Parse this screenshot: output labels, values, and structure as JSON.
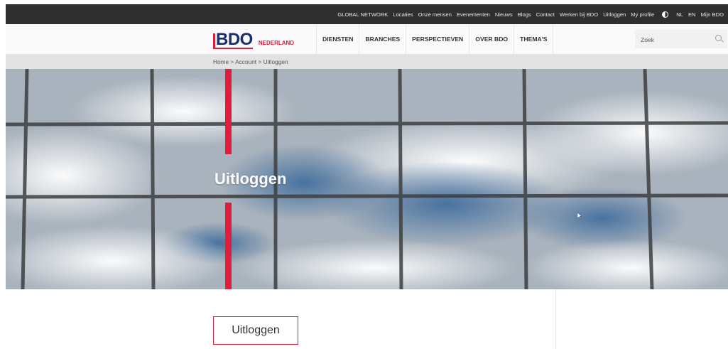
{
  "topbar": {
    "links": [
      "GLOBAL NETWORK",
      "Locaties",
      "Onze mensen",
      "Evenementen",
      "Nieuws",
      "Blogs",
      "Contact",
      "Werken bij BDO",
      "Uitloggen",
      "My profile"
    ],
    "languages": [
      "NL",
      "EN"
    ],
    "mijn_bdo": "Mijn BDO"
  },
  "logo": {
    "brand": "BDO",
    "country": "NEDERLAND"
  },
  "nav": {
    "items": [
      "DIENSTEN",
      "BRANCHES",
      "PERSPECTIEVEN",
      "OVER BDO",
      "THEMA'S"
    ]
  },
  "search": {
    "placeholder": "Zoek"
  },
  "breadcrumb": {
    "text": "Home > Account > Uitloggen"
  },
  "hero": {
    "title": "Uitloggen"
  },
  "content": {
    "button_label": "Uitloggen"
  },
  "colors": {
    "accent": "#e21c3b",
    "brand_blue": "#1a2f6e",
    "topbar": "#2f2f2f"
  },
  "icons": [
    "contrast-icon",
    "search-icon"
  ]
}
